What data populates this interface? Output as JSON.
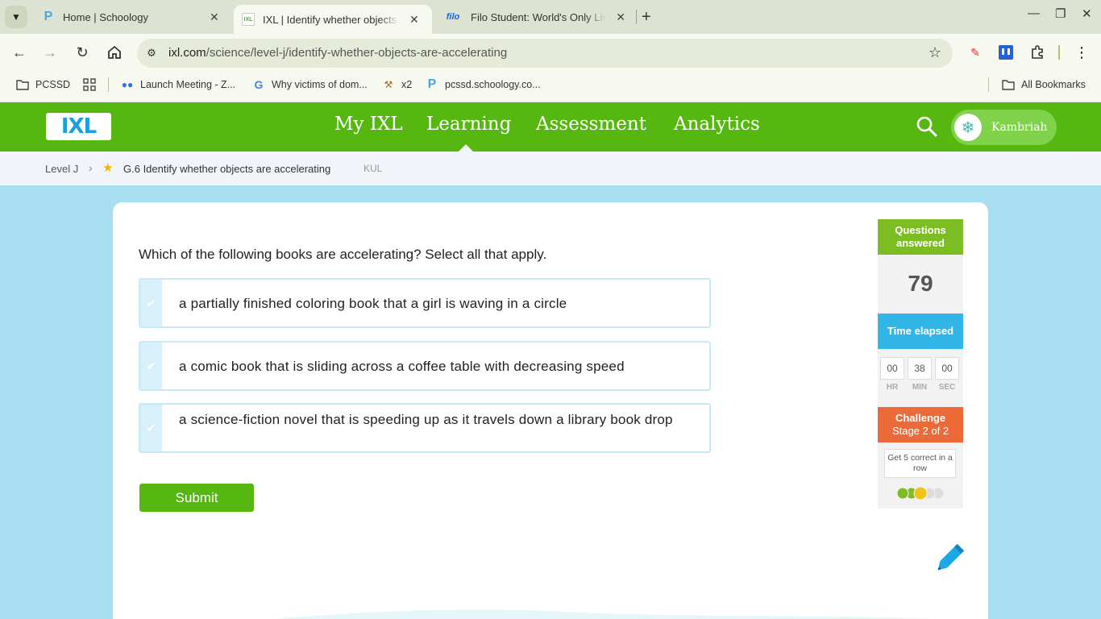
{
  "browser": {
    "tabs": [
      {
        "title": "Home | Schoology",
        "favicon": "schoology-p-icon"
      },
      {
        "title": "IXL | Identify whether objects are accelerating",
        "favicon": "ixl-icon",
        "active": true
      },
      {
        "title": "Filo Student: World's Only Live Instant Tutoring",
        "favicon": "filo-icon",
        "favicon_text": "filo"
      }
    ],
    "url_host": "ixl.com",
    "url_path": "/science/level-j/identify-whether-objects-are-accelerating",
    "bookmarks": [
      {
        "label": "PCSSD",
        "icon": "folder-icon"
      },
      {
        "label": "Launch Meeting - Z...",
        "icon": "zoom-people-icon"
      },
      {
        "label": "Why victims of dom...",
        "icon": "google-icon"
      },
      {
        "label": "x2",
        "icon": "tool-icon"
      },
      {
        "label": "pcssd.schoology.co...",
        "icon": "schoology-p-icon"
      }
    ],
    "all_bookmarks": "All Bookmarks"
  },
  "header": {
    "logo": "IXL",
    "nav": [
      "My IXL",
      "Learning",
      "Assessment",
      "Analytics"
    ],
    "active_nav": "Learning",
    "user": "Kambriah"
  },
  "breadcrumb": {
    "level": "Level J",
    "skill": "G.6 Identify whether objects are accelerating",
    "code": "KUL"
  },
  "practice": {
    "question": "Which of the following books are accelerating? Select all that apply.",
    "choices": [
      "a partially finished coloring book that a girl is waving in a circle",
      "a comic book that is sliding across a coffee table with decreasing speed",
      "a science-fiction novel that is speeding up as it travels down a library book drop"
    ],
    "submit": "Submit"
  },
  "stats": {
    "questions_label": "Questions answered",
    "questions_count": "79",
    "time_label": "Time elapsed",
    "time": {
      "hr": "00",
      "min": "38",
      "sec": "00"
    },
    "time_units": {
      "hr": "HR",
      "min": "MIN",
      "sec": "SEC"
    },
    "challenge_label": "Challenge",
    "challenge_stage": "Stage 2 of 2",
    "challenge_goal": "Get 5 correct in a row",
    "challenge_progress": 2,
    "challenge_total": 5
  },
  "colors": {
    "ixl_green": "#56b711",
    "stat_green": "#7cbd24",
    "stat_blue": "#31b6e7",
    "stat_orange": "#ec6a37",
    "choice_border": "#c8e9f6"
  }
}
